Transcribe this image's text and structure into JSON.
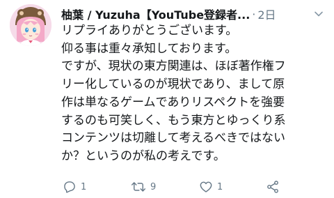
{
  "tweet": {
    "author_name": "柚葉 / Yuzuha【YouTube登録者...",
    "separator": "·",
    "timestamp": "2日",
    "avatar_icon": "user-avatar-illustration",
    "more_icon": "chevron-down-icon",
    "text_lines": [
      "リプライありがとうございます。",
      "仰る事は重々承知しております。",
      "ですが、現状の東方関連は、ほぼ著作権フ",
      "リー化しているのが現状であり、まして原",
      "作は単なるゲームでありリスペクトを強要",
      "するのも可笑しく、もう東方とゆっくり系",
      "コンテンツは切離して考えるべきではない",
      "か？というのが私の考えです。"
    ],
    "actions": {
      "reply": {
        "icon": "reply-icon",
        "count": "1"
      },
      "retweet": {
        "icon": "retweet-icon",
        "count": "9"
      },
      "like": {
        "icon": "heart-icon",
        "count": "1"
      },
      "share": {
        "icon": "share-icon"
      }
    },
    "colors": {
      "text": "#14171a",
      "muted": "#657786"
    }
  }
}
